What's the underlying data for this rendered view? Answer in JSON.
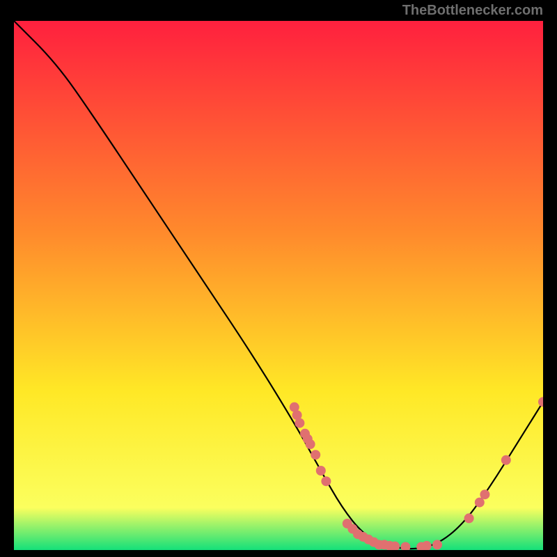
{
  "attribution": "TheBottlenecker.com",
  "chart_data": {
    "type": "line",
    "title": "",
    "xlabel": "",
    "ylabel": "",
    "xlim": [
      0,
      100
    ],
    "ylim": [
      0,
      100
    ],
    "background_gradient": {
      "top": "#ff203e",
      "mid1": "#ff8a2c",
      "mid2": "#ffe826",
      "mid3": "#fbff5e",
      "bottom": "#14e07a"
    },
    "curve": [
      {
        "x": 0,
        "y": 100
      },
      {
        "x": 8,
        "y": 92
      },
      {
        "x": 15,
        "y": 82
      },
      {
        "x": 25,
        "y": 67
      },
      {
        "x": 35,
        "y": 52
      },
      {
        "x": 45,
        "y": 37
      },
      {
        "x": 53,
        "y": 24
      },
      {
        "x": 58,
        "y": 15
      },
      {
        "x": 62,
        "y": 8
      },
      {
        "x": 66,
        "y": 3
      },
      {
        "x": 70,
        "y": 1
      },
      {
        "x": 75,
        "y": 0
      },
      {
        "x": 80,
        "y": 1
      },
      {
        "x": 85,
        "y": 5
      },
      {
        "x": 90,
        "y": 12
      },
      {
        "x": 95,
        "y": 20
      },
      {
        "x": 100,
        "y": 28
      }
    ],
    "markers": [
      {
        "x": 53,
        "y": 27
      },
      {
        "x": 53.5,
        "y": 25.5
      },
      {
        "x": 54,
        "y": 24
      },
      {
        "x": 55,
        "y": 22
      },
      {
        "x": 55.5,
        "y": 21
      },
      {
        "x": 56,
        "y": 20
      },
      {
        "x": 57,
        "y": 18
      },
      {
        "x": 58,
        "y": 15
      },
      {
        "x": 59,
        "y": 13
      },
      {
        "x": 63,
        "y": 5
      },
      {
        "x": 64,
        "y": 4
      },
      {
        "x": 65,
        "y": 3
      },
      {
        "x": 66,
        "y": 2.5
      },
      {
        "x": 67,
        "y": 2
      },
      {
        "x": 68,
        "y": 1.5
      },
      {
        "x": 69,
        "y": 1
      },
      {
        "x": 70,
        "y": 1
      },
      {
        "x": 71,
        "y": 0.8
      },
      {
        "x": 72,
        "y": 0.7
      },
      {
        "x": 74,
        "y": 0.6
      },
      {
        "x": 77,
        "y": 0.6
      },
      {
        "x": 78,
        "y": 0.8
      },
      {
        "x": 80,
        "y": 1
      },
      {
        "x": 86,
        "y": 6
      },
      {
        "x": 88,
        "y": 9
      },
      {
        "x": 89,
        "y": 10.5
      },
      {
        "x": 93,
        "y": 17
      },
      {
        "x": 100,
        "y": 28
      }
    ],
    "marker_color": "#e07070",
    "curve_color": "#000000"
  }
}
